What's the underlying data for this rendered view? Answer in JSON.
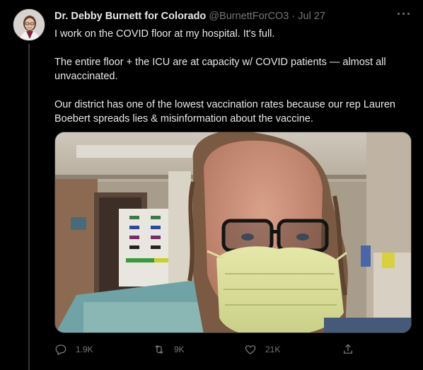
{
  "tweet": {
    "author": {
      "display_name": "Dr. Debby Burnett for Colorado",
      "handle": "@BurnettForCO3",
      "separator": "·",
      "date": "Jul 27"
    },
    "paragraphs": [
      "I work on the COVID floor at my hospital. It's full.",
      "The entire floor + the ICU are at capacity w/ COVID patients — almost all unvaccinated.",
      "Our district has one of the lowest vaccination rates because our rep Lauren Boebert spreads lies & misinformation about the vaccine."
    ],
    "stats": {
      "replies": "1.9K",
      "retweets": "9K",
      "likes": "21K"
    },
    "icons": {
      "reply": "reply-icon",
      "retweet": "retweet-icon",
      "like": "heart-icon",
      "share": "share-icon",
      "more": "more-icon"
    }
  },
  "colors": {
    "background": "#000000",
    "text": "#e7e9ea",
    "muted": "#71767b",
    "border": "#2f3336"
  }
}
